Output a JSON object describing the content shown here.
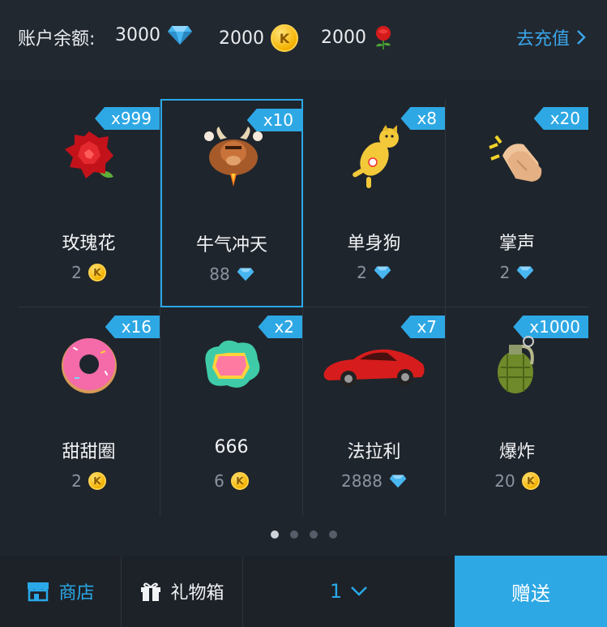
{
  "header": {
    "balance_label": "账户余额:",
    "diamond_amount": "3000",
    "coin_amount": "2000",
    "rose_amount": "2000",
    "recharge_label": "去充值"
  },
  "gifts": [
    {
      "name": "玫瑰花",
      "badge": "x999",
      "price": "2",
      "currency": "coin",
      "icon": "rose-icon"
    },
    {
      "name": "牛气冲天",
      "badge": "x10",
      "price": "88",
      "currency": "diamond",
      "icon": "bull-icon"
    },
    {
      "name": "单身狗",
      "badge": "x8",
      "price": "2",
      "currency": "diamond",
      "icon": "dog-icon"
    },
    {
      "name": "掌声",
      "badge": "x20",
      "price": "2",
      "currency": "diamond",
      "icon": "clap-icon"
    },
    {
      "name": "甜甜圈",
      "badge": "x16",
      "price": "2",
      "currency": "coin",
      "icon": "donut-icon"
    },
    {
      "name": "666",
      "badge": "x2",
      "price": "6",
      "currency": "coin",
      "icon": "666-icon"
    },
    {
      "name": "法拉利",
      "badge": "x7",
      "price": "2888",
      "currency": "diamond",
      "icon": "car-icon"
    },
    {
      "name": "爆炸",
      "badge": "x1000",
      "price": "20",
      "currency": "coin",
      "icon": "grenade-icon"
    }
  ],
  "selected_index": 1,
  "pagination": {
    "pages": 4,
    "current": 1
  },
  "footer": {
    "store_label": "商店",
    "giftbox_label": "礼物箱",
    "quantity": "1",
    "send_label": "赠送"
  },
  "coin_glyph": "K",
  "colors": {
    "accent": "#2ea8e4",
    "background": "#1f252c",
    "muted": "#8b93a0"
  }
}
